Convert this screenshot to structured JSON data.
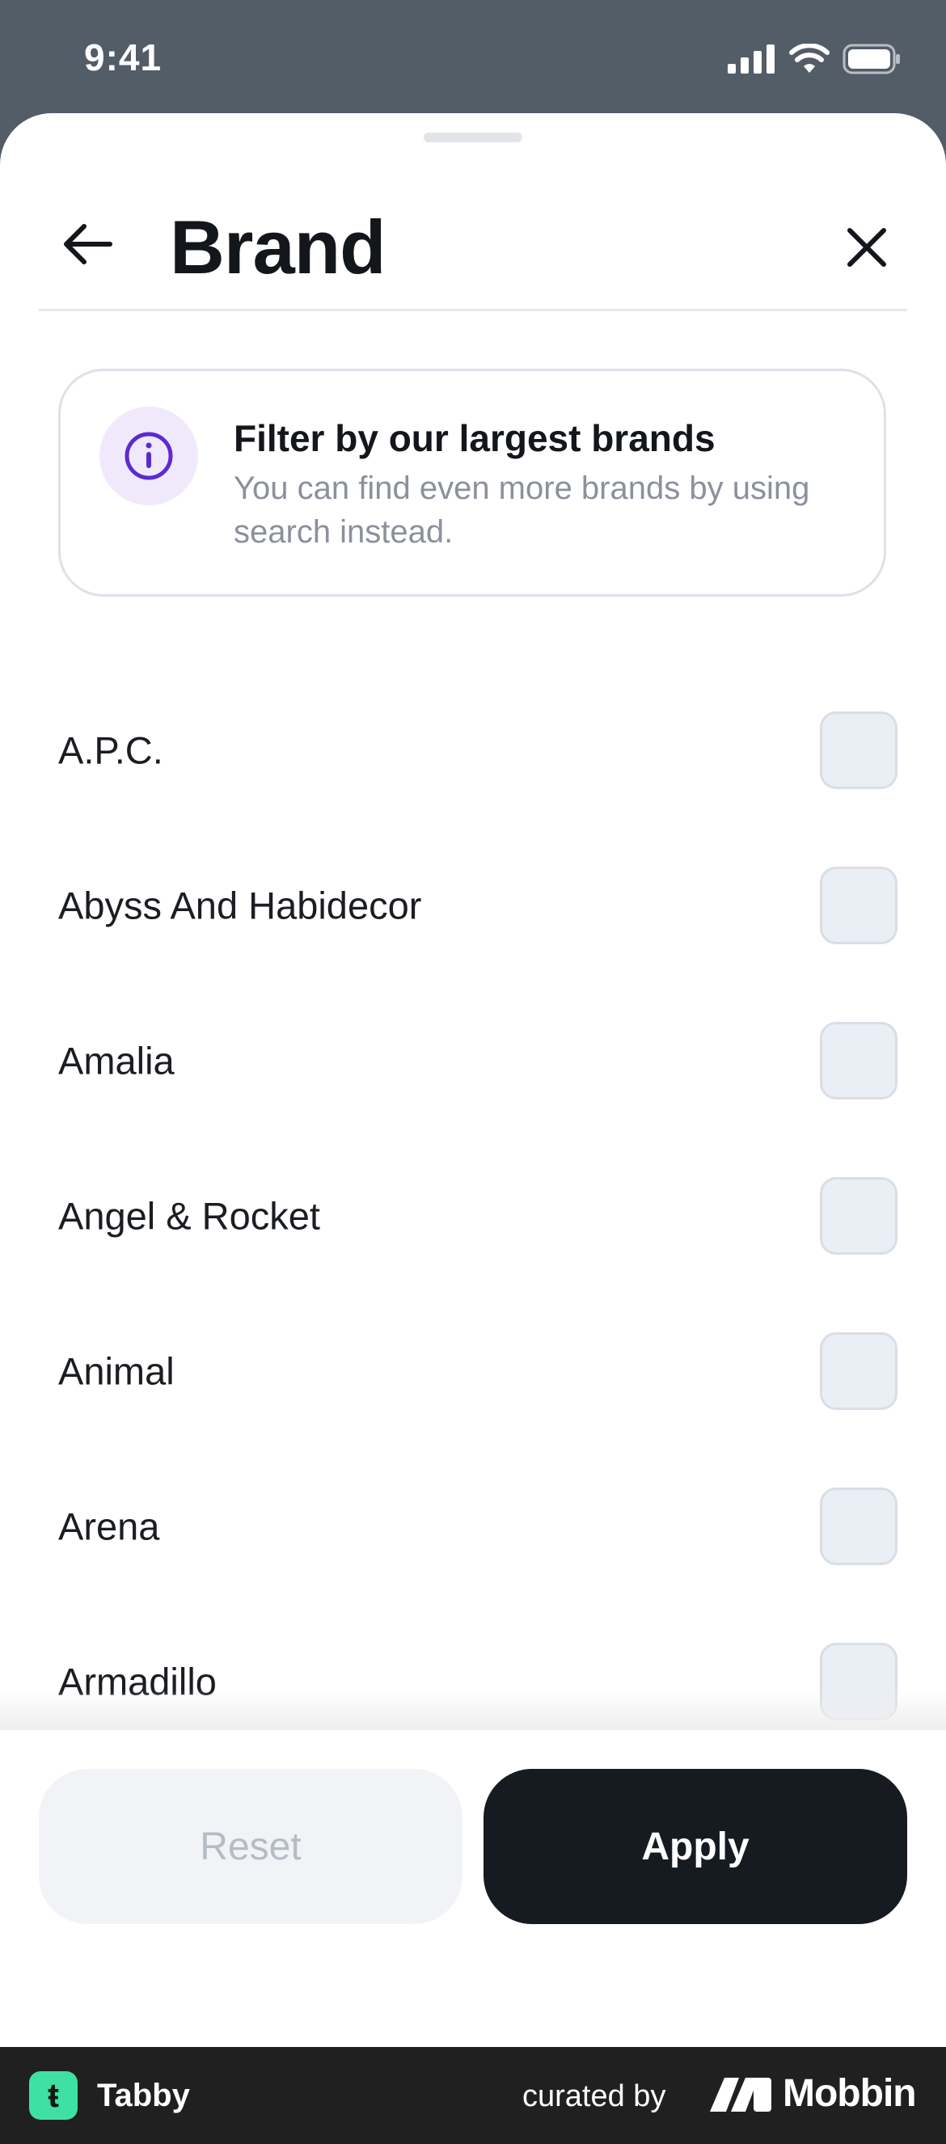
{
  "status_bar": {
    "time": "9:41"
  },
  "header": {
    "title": "Brand"
  },
  "info_card": {
    "title": "Filter by our largest brands",
    "subtitle": "You can find even more brands by using search instead."
  },
  "brands": [
    {
      "label": "A.P.C.",
      "checked": false
    },
    {
      "label": "Abyss And Habidecor",
      "checked": false
    },
    {
      "label": "Amalia",
      "checked": false
    },
    {
      "label": "Angel & Rocket",
      "checked": false
    },
    {
      "label": "Animal",
      "checked": false
    },
    {
      "label": "Arena",
      "checked": false
    },
    {
      "label": "Armadillo",
      "checked": false
    }
  ],
  "footer": {
    "reset_label": "Reset",
    "apply_label": "Apply"
  },
  "watermark": {
    "app_name": "Tabby",
    "app_logo_glyph": "ŧ",
    "curated_by": "curated by",
    "brand": "Mobbin"
  },
  "colors": {
    "accent_purple": "#5b2bd1",
    "apply_bg": "#161b22",
    "tabby_green": "#3fe0a3"
  }
}
